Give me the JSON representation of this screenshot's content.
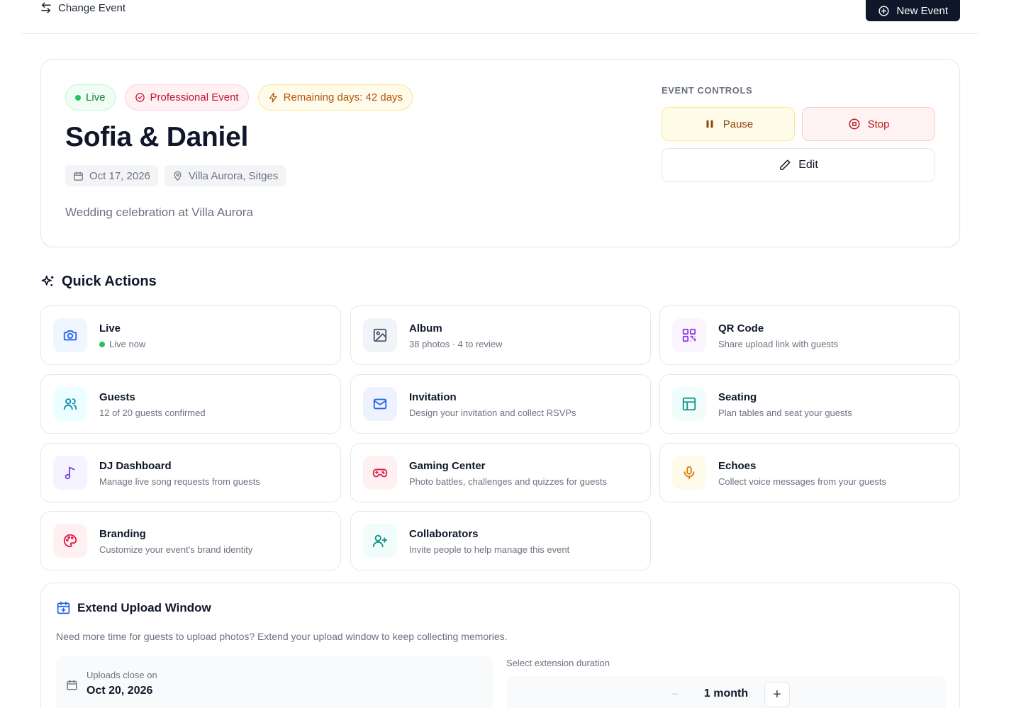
{
  "topbar": {
    "change_event_label": "Change Event",
    "new_event_label": "New Event"
  },
  "event": {
    "badges": {
      "live": "Live",
      "type": "Professional Event",
      "remaining": "Remaining days: 42 days"
    },
    "title": "Sofia & Daniel",
    "date": "Oct 17, 2026",
    "location": "Villa Aurora, Sitges",
    "description": "Wedding celebration at Villa Aurora",
    "controls": {
      "label": "EVENT CONTROLS",
      "pause": "Pause",
      "stop": "Stop",
      "edit": "Edit"
    }
  },
  "quick_actions": {
    "title": "Quick Actions",
    "items": [
      {
        "title": "Live",
        "subtitle": "Live now",
        "icon": "camera-icon",
        "color": "#2563eb",
        "bg": "#eff6ff"
      },
      {
        "title": "Album",
        "subtitle": "38 photos · 4 to review",
        "icon": "image-icon",
        "color": "#475569",
        "bg": "#f1f5f9"
      },
      {
        "title": "QR Code",
        "subtitle": "Share upload link with guests",
        "icon": "qr-code-icon",
        "color": "#9333ea",
        "bg": "#faf5ff"
      },
      {
        "title": "Guests",
        "subtitle": "12 of 20 guests confirmed",
        "icon": "users-icon",
        "color": "#0891b2",
        "bg": "#ecfeff"
      },
      {
        "title": "Invitation",
        "subtitle": "Design your invitation and collect RSVPs",
        "icon": "mail-icon",
        "color": "#2563eb",
        "bg": "#eef2ff"
      },
      {
        "title": "Seating",
        "subtitle": "Plan tables and seat your guests",
        "icon": "layout-icon",
        "color": "#0d9488",
        "bg": "#f0fdfa"
      },
      {
        "title": "DJ Dashboard",
        "subtitle": "Manage live song requests from guests",
        "icon": "music-icon",
        "color": "#7c3aed",
        "bg": "#f5f3ff"
      },
      {
        "title": "Gaming Center",
        "subtitle": "Photo battles, challenges and quizzes for guests",
        "icon": "gamepad-icon",
        "color": "#e11d48",
        "bg": "#fff1f2"
      },
      {
        "title": "Echoes",
        "subtitle": "Collect voice messages from your guests",
        "icon": "mic-icon",
        "color": "#d97706",
        "bg": "#fffbeb"
      },
      {
        "title": "Branding",
        "subtitle": "Customize your event's brand identity",
        "icon": "palette-icon",
        "color": "#e11d48",
        "bg": "#fff1f2"
      },
      {
        "title": "Collaborators",
        "subtitle": "Invite people to help manage this event",
        "icon": "user-plus-icon",
        "color": "#0d9488",
        "bg": "#f0fdfa"
      }
    ]
  },
  "extend": {
    "title": "Extend Upload Window",
    "description": "Need more time for guests to upload photos? Extend your upload window to keep collecting memories.",
    "uploads_label": "Uploads close on",
    "uploads_date": "Oct 20, 2026",
    "duration_label": "Select extension duration",
    "duration_value": "1 month"
  }
}
